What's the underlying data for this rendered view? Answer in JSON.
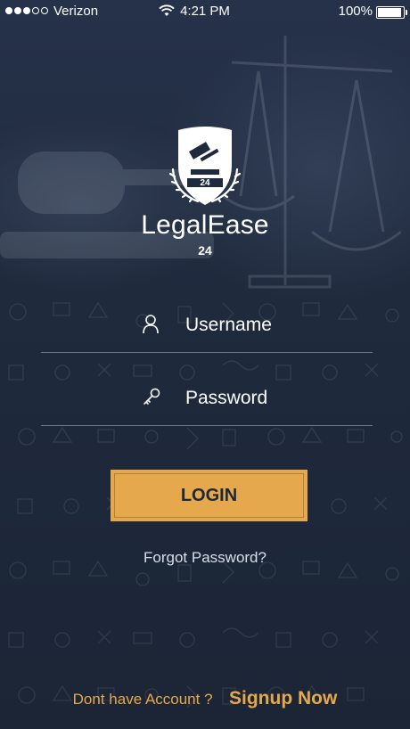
{
  "status_bar": {
    "carrier": "Verizon",
    "time": "4:21 PM",
    "battery": "100%",
    "signal_strength": 3,
    "signal_max": 5
  },
  "brand": {
    "name": "LegalEase",
    "sub": "24",
    "badge_number": "24"
  },
  "form": {
    "username_placeholder": "Username",
    "password_placeholder": "Password",
    "login_label": "LOGIN",
    "forgot_label": "Forgot Password?"
  },
  "footer": {
    "no_account_text": "Dont have Account ?",
    "signup_label": "Signup Now"
  },
  "colors": {
    "background": "#1d2838",
    "accent": "#e5a84d",
    "text": "#ffffff"
  },
  "icons": {
    "username": "user-icon",
    "password": "key-icon",
    "wifi": "wifi-icon",
    "battery": "battery-icon"
  }
}
